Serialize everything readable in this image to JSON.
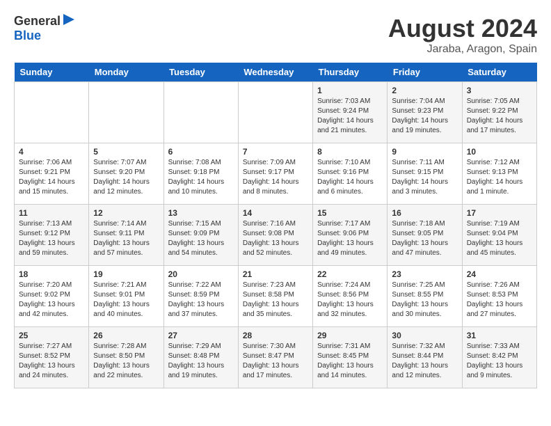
{
  "logo": {
    "general": "General",
    "blue": "Blue"
  },
  "title": {
    "month_year": "August 2024",
    "location": "Jaraba, Aragon, Spain"
  },
  "days_of_week": [
    "Sunday",
    "Monday",
    "Tuesday",
    "Wednesday",
    "Thursday",
    "Friday",
    "Saturday"
  ],
  "weeks": [
    [
      {
        "day": "",
        "info": ""
      },
      {
        "day": "",
        "info": ""
      },
      {
        "day": "",
        "info": ""
      },
      {
        "day": "",
        "info": ""
      },
      {
        "day": "1",
        "info": "Sunrise: 7:03 AM\nSunset: 9:24 PM\nDaylight: 14 hours\nand 21 minutes."
      },
      {
        "day": "2",
        "info": "Sunrise: 7:04 AM\nSunset: 9:23 PM\nDaylight: 14 hours\nand 19 minutes."
      },
      {
        "day": "3",
        "info": "Sunrise: 7:05 AM\nSunset: 9:22 PM\nDaylight: 14 hours\nand 17 minutes."
      }
    ],
    [
      {
        "day": "4",
        "info": "Sunrise: 7:06 AM\nSunset: 9:21 PM\nDaylight: 14 hours\nand 15 minutes."
      },
      {
        "day": "5",
        "info": "Sunrise: 7:07 AM\nSunset: 9:20 PM\nDaylight: 14 hours\nand 12 minutes."
      },
      {
        "day": "6",
        "info": "Sunrise: 7:08 AM\nSunset: 9:18 PM\nDaylight: 14 hours\nand 10 minutes."
      },
      {
        "day": "7",
        "info": "Sunrise: 7:09 AM\nSunset: 9:17 PM\nDaylight: 14 hours\nand 8 minutes."
      },
      {
        "day": "8",
        "info": "Sunrise: 7:10 AM\nSunset: 9:16 PM\nDaylight: 14 hours\nand 6 minutes."
      },
      {
        "day": "9",
        "info": "Sunrise: 7:11 AM\nSunset: 9:15 PM\nDaylight: 14 hours\nand 3 minutes."
      },
      {
        "day": "10",
        "info": "Sunrise: 7:12 AM\nSunset: 9:13 PM\nDaylight: 14 hours\nand 1 minute."
      }
    ],
    [
      {
        "day": "11",
        "info": "Sunrise: 7:13 AM\nSunset: 9:12 PM\nDaylight: 13 hours\nand 59 minutes."
      },
      {
        "day": "12",
        "info": "Sunrise: 7:14 AM\nSunset: 9:11 PM\nDaylight: 13 hours\nand 57 minutes."
      },
      {
        "day": "13",
        "info": "Sunrise: 7:15 AM\nSunset: 9:09 PM\nDaylight: 13 hours\nand 54 minutes."
      },
      {
        "day": "14",
        "info": "Sunrise: 7:16 AM\nSunset: 9:08 PM\nDaylight: 13 hours\nand 52 minutes."
      },
      {
        "day": "15",
        "info": "Sunrise: 7:17 AM\nSunset: 9:06 PM\nDaylight: 13 hours\nand 49 minutes."
      },
      {
        "day": "16",
        "info": "Sunrise: 7:18 AM\nSunset: 9:05 PM\nDaylight: 13 hours\nand 47 minutes."
      },
      {
        "day": "17",
        "info": "Sunrise: 7:19 AM\nSunset: 9:04 PM\nDaylight: 13 hours\nand 45 minutes."
      }
    ],
    [
      {
        "day": "18",
        "info": "Sunrise: 7:20 AM\nSunset: 9:02 PM\nDaylight: 13 hours\nand 42 minutes."
      },
      {
        "day": "19",
        "info": "Sunrise: 7:21 AM\nSunset: 9:01 PM\nDaylight: 13 hours\nand 40 minutes."
      },
      {
        "day": "20",
        "info": "Sunrise: 7:22 AM\nSunset: 8:59 PM\nDaylight: 13 hours\nand 37 minutes."
      },
      {
        "day": "21",
        "info": "Sunrise: 7:23 AM\nSunset: 8:58 PM\nDaylight: 13 hours\nand 35 minutes."
      },
      {
        "day": "22",
        "info": "Sunrise: 7:24 AM\nSunset: 8:56 PM\nDaylight: 13 hours\nand 32 minutes."
      },
      {
        "day": "23",
        "info": "Sunrise: 7:25 AM\nSunset: 8:55 PM\nDaylight: 13 hours\nand 30 minutes."
      },
      {
        "day": "24",
        "info": "Sunrise: 7:26 AM\nSunset: 8:53 PM\nDaylight: 13 hours\nand 27 minutes."
      }
    ],
    [
      {
        "day": "25",
        "info": "Sunrise: 7:27 AM\nSunset: 8:52 PM\nDaylight: 13 hours\nand 24 minutes."
      },
      {
        "day": "26",
        "info": "Sunrise: 7:28 AM\nSunset: 8:50 PM\nDaylight: 13 hours\nand 22 minutes."
      },
      {
        "day": "27",
        "info": "Sunrise: 7:29 AM\nSunset: 8:48 PM\nDaylight: 13 hours\nand 19 minutes."
      },
      {
        "day": "28",
        "info": "Sunrise: 7:30 AM\nSunset: 8:47 PM\nDaylight: 13 hours\nand 17 minutes."
      },
      {
        "day": "29",
        "info": "Sunrise: 7:31 AM\nSunset: 8:45 PM\nDaylight: 13 hours\nand 14 minutes."
      },
      {
        "day": "30",
        "info": "Sunrise: 7:32 AM\nSunset: 8:44 PM\nDaylight: 13 hours\nand 12 minutes."
      },
      {
        "day": "31",
        "info": "Sunrise: 7:33 AM\nSunset: 8:42 PM\nDaylight: 13 hours\nand 9 minutes."
      }
    ]
  ]
}
